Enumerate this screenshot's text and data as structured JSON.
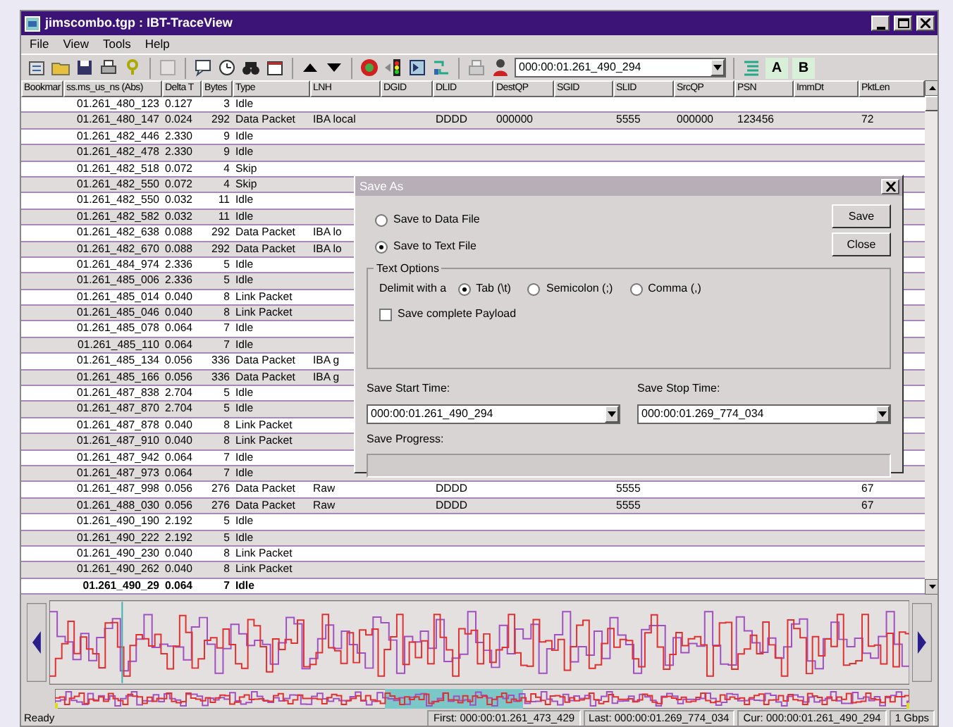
{
  "window": {
    "title": "jimscombo.tgp : IBT-TraceView"
  },
  "menu": [
    "File",
    "View",
    "Tools",
    "Help"
  ],
  "toolbar": {
    "time_field": {
      "value": "000:00:01.261_490_294"
    },
    "marker_buttons": [
      "A",
      "B"
    ]
  },
  "table": {
    "columns": [
      "Bookmar",
      "ss.ms_us_ns (Abs)",
      "Delta T",
      "Bytes",
      "Type",
      "LNH",
      "DGID",
      "DLID",
      "DestQP",
      "SGID",
      "SLID",
      "SrcQP",
      "PSN",
      "ImmDt",
      "PktLen"
    ],
    "rows": [
      {
        "time": "01.261_480_123",
        "delta_t": "0.127",
        "bytes": "3",
        "type": "Idle",
        "selected": false
      },
      {
        "time": "01.261_480_147",
        "delta_t": "0.024",
        "bytes": "292",
        "type": "Data Packet",
        "lnh": "IBA local",
        "dlid": "DDDD",
        "destqp": "000000",
        "slid": "5555",
        "srcqp": "000000",
        "psn": "123456",
        "pktlen": "72",
        "selected": false
      },
      {
        "time": "01.261_482_446",
        "delta_t": "2.330",
        "bytes": "9",
        "type": "Idle",
        "selected": false
      },
      {
        "time": "01.261_482_478",
        "delta_t": "2.330",
        "bytes": "9",
        "type": "Idle",
        "selected": false
      },
      {
        "time": "01.261_482_518",
        "delta_t": "0.072",
        "bytes": "4",
        "type": "Skip",
        "selected": false
      },
      {
        "time": "01.261_482_550",
        "delta_t": "0.072",
        "bytes": "4",
        "type": "Skip",
        "selected": false
      },
      {
        "time": "01.261_482_550",
        "delta_t": "0.032",
        "bytes": "11",
        "type": "Idle",
        "selected": false
      },
      {
        "time": "01.261_482_582",
        "delta_t": "0.032",
        "bytes": "11",
        "type": "Idle",
        "selected": false
      },
      {
        "time": "01.261_482_638",
        "delta_t": "0.088",
        "bytes": "292",
        "type": "Data Packet",
        "lnh": "IBA lo",
        "selected": false
      },
      {
        "time": "01.261_482_670",
        "delta_t": "0.088",
        "bytes": "292",
        "type": "Data Packet",
        "lnh": "IBA lo",
        "selected": false
      },
      {
        "time": "01.261_484_974",
        "delta_t": "2.336",
        "bytes": "5",
        "type": "Idle",
        "selected": false
      },
      {
        "time": "01.261_485_006",
        "delta_t": "2.336",
        "bytes": "5",
        "type": "Idle",
        "selected": false
      },
      {
        "time": "01.261_485_014",
        "delta_t": "0.040",
        "bytes": "8",
        "type": "Link Packet",
        "selected": false
      },
      {
        "time": "01.261_485_046",
        "delta_t": "0.040",
        "bytes": "8",
        "type": "Link Packet",
        "selected": false
      },
      {
        "time": "01.261_485_078",
        "delta_t": "0.064",
        "bytes": "7",
        "type": "Idle",
        "selected": false
      },
      {
        "time": "01.261_485_110",
        "delta_t": "0.064",
        "bytes": "7",
        "type": "Idle",
        "selected": false
      },
      {
        "time": "01.261_485_134",
        "delta_t": "0.056",
        "bytes": "336",
        "type": "Data Packet",
        "lnh": "IBA g",
        "selected": false
      },
      {
        "time": "01.261_485_166",
        "delta_t": "0.056",
        "bytes": "336",
        "type": "Data Packet",
        "lnh": "IBA g",
        "selected": false
      },
      {
        "time": "01.261_487_838",
        "delta_t": "2.704",
        "bytes": "5",
        "type": "Idle",
        "selected": false
      },
      {
        "time": "01.261_487_870",
        "delta_t": "2.704",
        "bytes": "5",
        "type": "Idle",
        "selected": false
      },
      {
        "time": "01.261_487_878",
        "delta_t": "0.040",
        "bytes": "8",
        "type": "Link Packet",
        "selected": false
      },
      {
        "time": "01.261_487_910",
        "delta_t": "0.040",
        "bytes": "8",
        "type": "Link Packet",
        "selected": false
      },
      {
        "time": "01.261_487_942",
        "delta_t": "0.064",
        "bytes": "7",
        "type": "Idle",
        "selected": false
      },
      {
        "time": "01.261_487_973",
        "delta_t": "0.064",
        "bytes": "7",
        "type": "Idle",
        "selected": false
      },
      {
        "time": "01.261_487_998",
        "delta_t": "0.056",
        "bytes": "276",
        "type": "Data Packet",
        "lnh": "Raw",
        "dlid": "DDDD",
        "slid": "5555",
        "pktlen": "67",
        "selected": false
      },
      {
        "time": "01.261_488_030",
        "delta_t": "0.056",
        "bytes": "276",
        "type": "Data Packet",
        "lnh": "Raw",
        "dlid": "DDDD",
        "slid": "5555",
        "pktlen": "67",
        "selected": false
      },
      {
        "time": "01.261_490_190",
        "delta_t": "2.192",
        "bytes": "5",
        "type": "Idle",
        "selected": false
      },
      {
        "time": "01.261_490_222",
        "delta_t": "2.192",
        "bytes": "5",
        "type": "Idle",
        "selected": false
      },
      {
        "time": "01.261_490_230",
        "delta_t": "0.040",
        "bytes": "8",
        "type": "Link Packet",
        "selected": false
      },
      {
        "time": "01.261_490_262",
        "delta_t": "0.040",
        "bytes": "8",
        "type": "Link Packet",
        "selected": false
      },
      {
        "time": "01.261_490_29",
        "delta_t": "0.064",
        "bytes": "7",
        "type": "Idle",
        "selected": true
      }
    ]
  },
  "dialog": {
    "title": "Save As",
    "targets": [
      {
        "label": "Save to Data File",
        "selected": false
      },
      {
        "label": "Save to Text File",
        "selected": true
      }
    ],
    "buttons": [
      "Save",
      "Close"
    ],
    "text_options": {
      "title": "Text Options",
      "delimit_label": "Delimit with a",
      "delimiters": [
        {
          "label": "Tab (\\t)",
          "selected": true
        },
        {
          "label": "Semicolon (;)",
          "selected": false
        },
        {
          "label": "Comma (,)",
          "selected": false
        }
      ],
      "payload": {
        "label": "Save complete Payload",
        "checked": false
      }
    },
    "start": {
      "label": "Save Start Time:",
      "value": "000:00:01.261_490_294"
    },
    "stop": {
      "label": "Save Stop Time:",
      "value": "000:00:01.269_774_034"
    },
    "progress": {
      "label": "Save Progress:",
      "level": 0
    }
  },
  "status_bar": [
    "Ready",
    "First: 000:00:01.261_473_429",
    "Last: 000:00:01.269_774_034",
    "Cur: 000:00:01.261_490_294",
    "1 Gbps"
  ]
}
